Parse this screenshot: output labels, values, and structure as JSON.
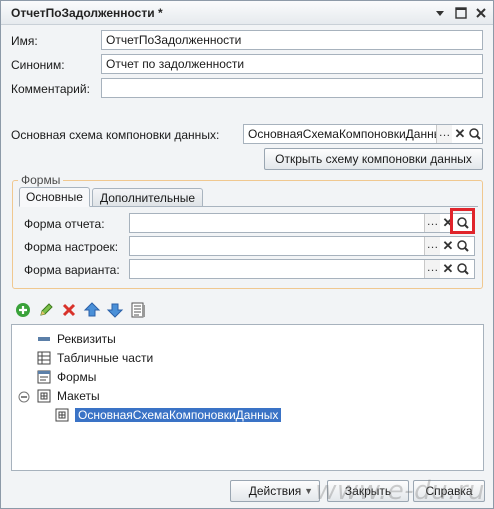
{
  "window": {
    "title": "ОтчетПоЗадолженности *"
  },
  "form": {
    "name_label": "Имя:",
    "name_value": "ОтчетПоЗадолженности",
    "synonym_label": "Синоним:",
    "synonym_value": "Отчет по задолженности",
    "comment_label": "Комментарий:",
    "comment_value": "",
    "dcs_label": "Основная схема компоновки данных:",
    "dcs_value": "ОсновнаяСхемаКомпоновкиДанных",
    "open_dcs_button": "Открыть схему компоновки данных"
  },
  "forms_group": {
    "title": "Формы",
    "tabs": [
      "Основные",
      "Дополнительные"
    ],
    "rows": [
      {
        "label": "Форма отчета:",
        "value": ""
      },
      {
        "label": "Форма настроек:",
        "value": ""
      },
      {
        "label": "Форма варианта:",
        "value": ""
      }
    ]
  },
  "tree": {
    "nodes": [
      {
        "label": "Реквизиты",
        "icon": "attribute-icon"
      },
      {
        "label": "Табличные части",
        "icon": "table-icon"
      },
      {
        "label": "Формы",
        "icon": "form-icon"
      },
      {
        "label": "Макеты",
        "icon": "template-icon",
        "expanded": true
      },
      {
        "label": "ОсновнаяСхемаКомпоновкиДанных",
        "icon": "template-icon",
        "selected": true
      }
    ]
  },
  "footer": {
    "actions_button": "Действия",
    "close_button": "Закрыть",
    "help_button": "Справка",
    "watermark": "www.e-du.ru"
  },
  "colors": {
    "highlight": "#e0242b",
    "selection": "#3a73c6",
    "group_border": "#f0c890"
  }
}
